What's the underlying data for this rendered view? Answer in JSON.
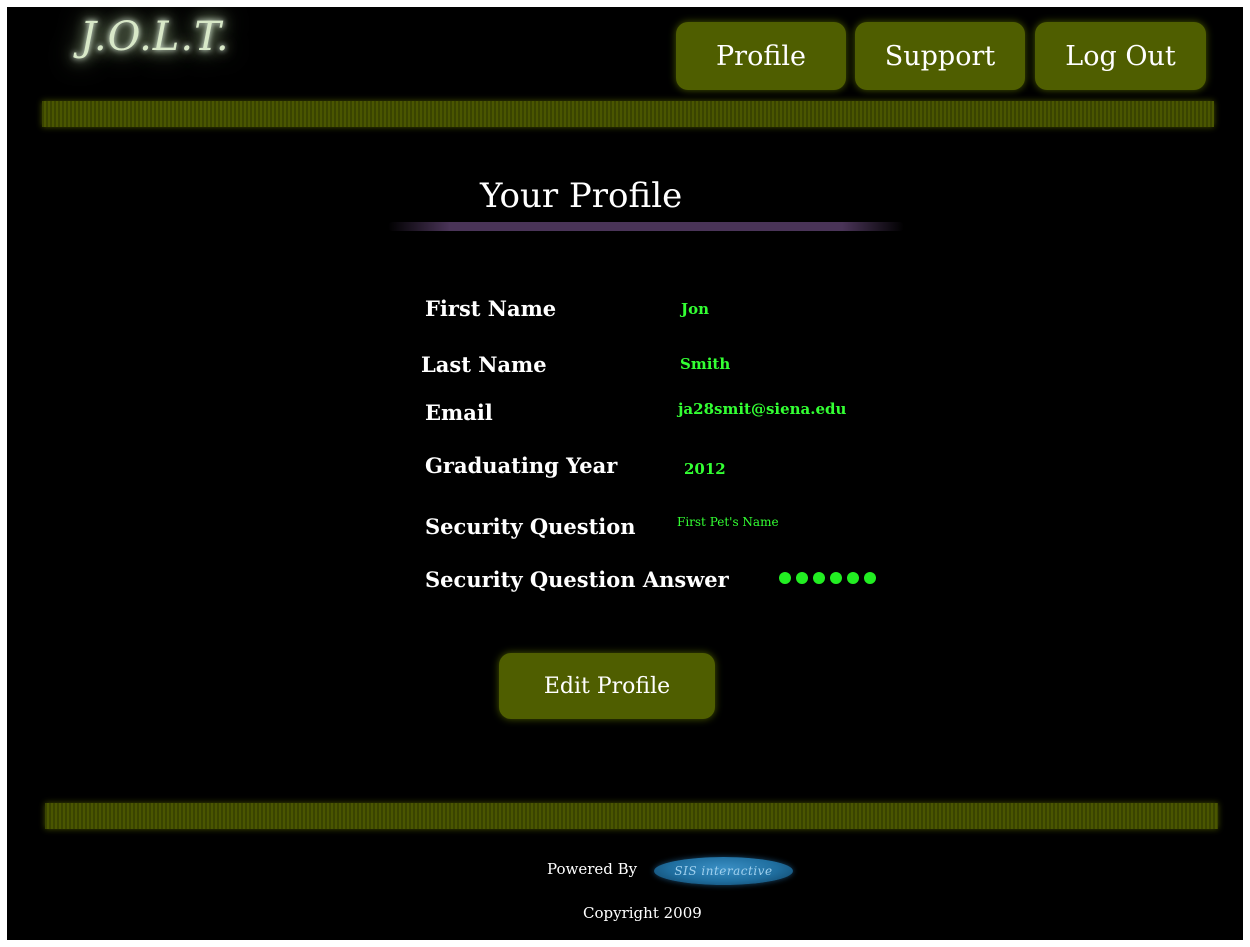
{
  "header": {
    "logo_text": "J.O.L.T.",
    "nav": {
      "profile": "Profile",
      "support": "Support",
      "logout": "Log Out"
    }
  },
  "main": {
    "title": "Your Profile",
    "fields": [
      {
        "label": "First Name",
        "value": "Jon"
      },
      {
        "label": "Last Name",
        "value": "Smith"
      },
      {
        "label": "Email",
        "value": "ja28smit@siena.edu"
      },
      {
        "label": "Graduating Year",
        "value": "2012"
      },
      {
        "label": "Security Question",
        "value": "First Pet's Name"
      },
      {
        "label": "Security Question Answer",
        "value": "●●●●●●"
      }
    ],
    "edit_button": "Edit Profile"
  },
  "footer": {
    "powered_by": "Powered By",
    "sponsor_logo_text": "SIS interactive",
    "copyright": "Copyright 2009"
  },
  "colors": {
    "background": "#000000",
    "button": "#4f5e00",
    "bar": "#4a5600",
    "value_text": "#33ff33",
    "accent_underline": "#4a3458"
  }
}
